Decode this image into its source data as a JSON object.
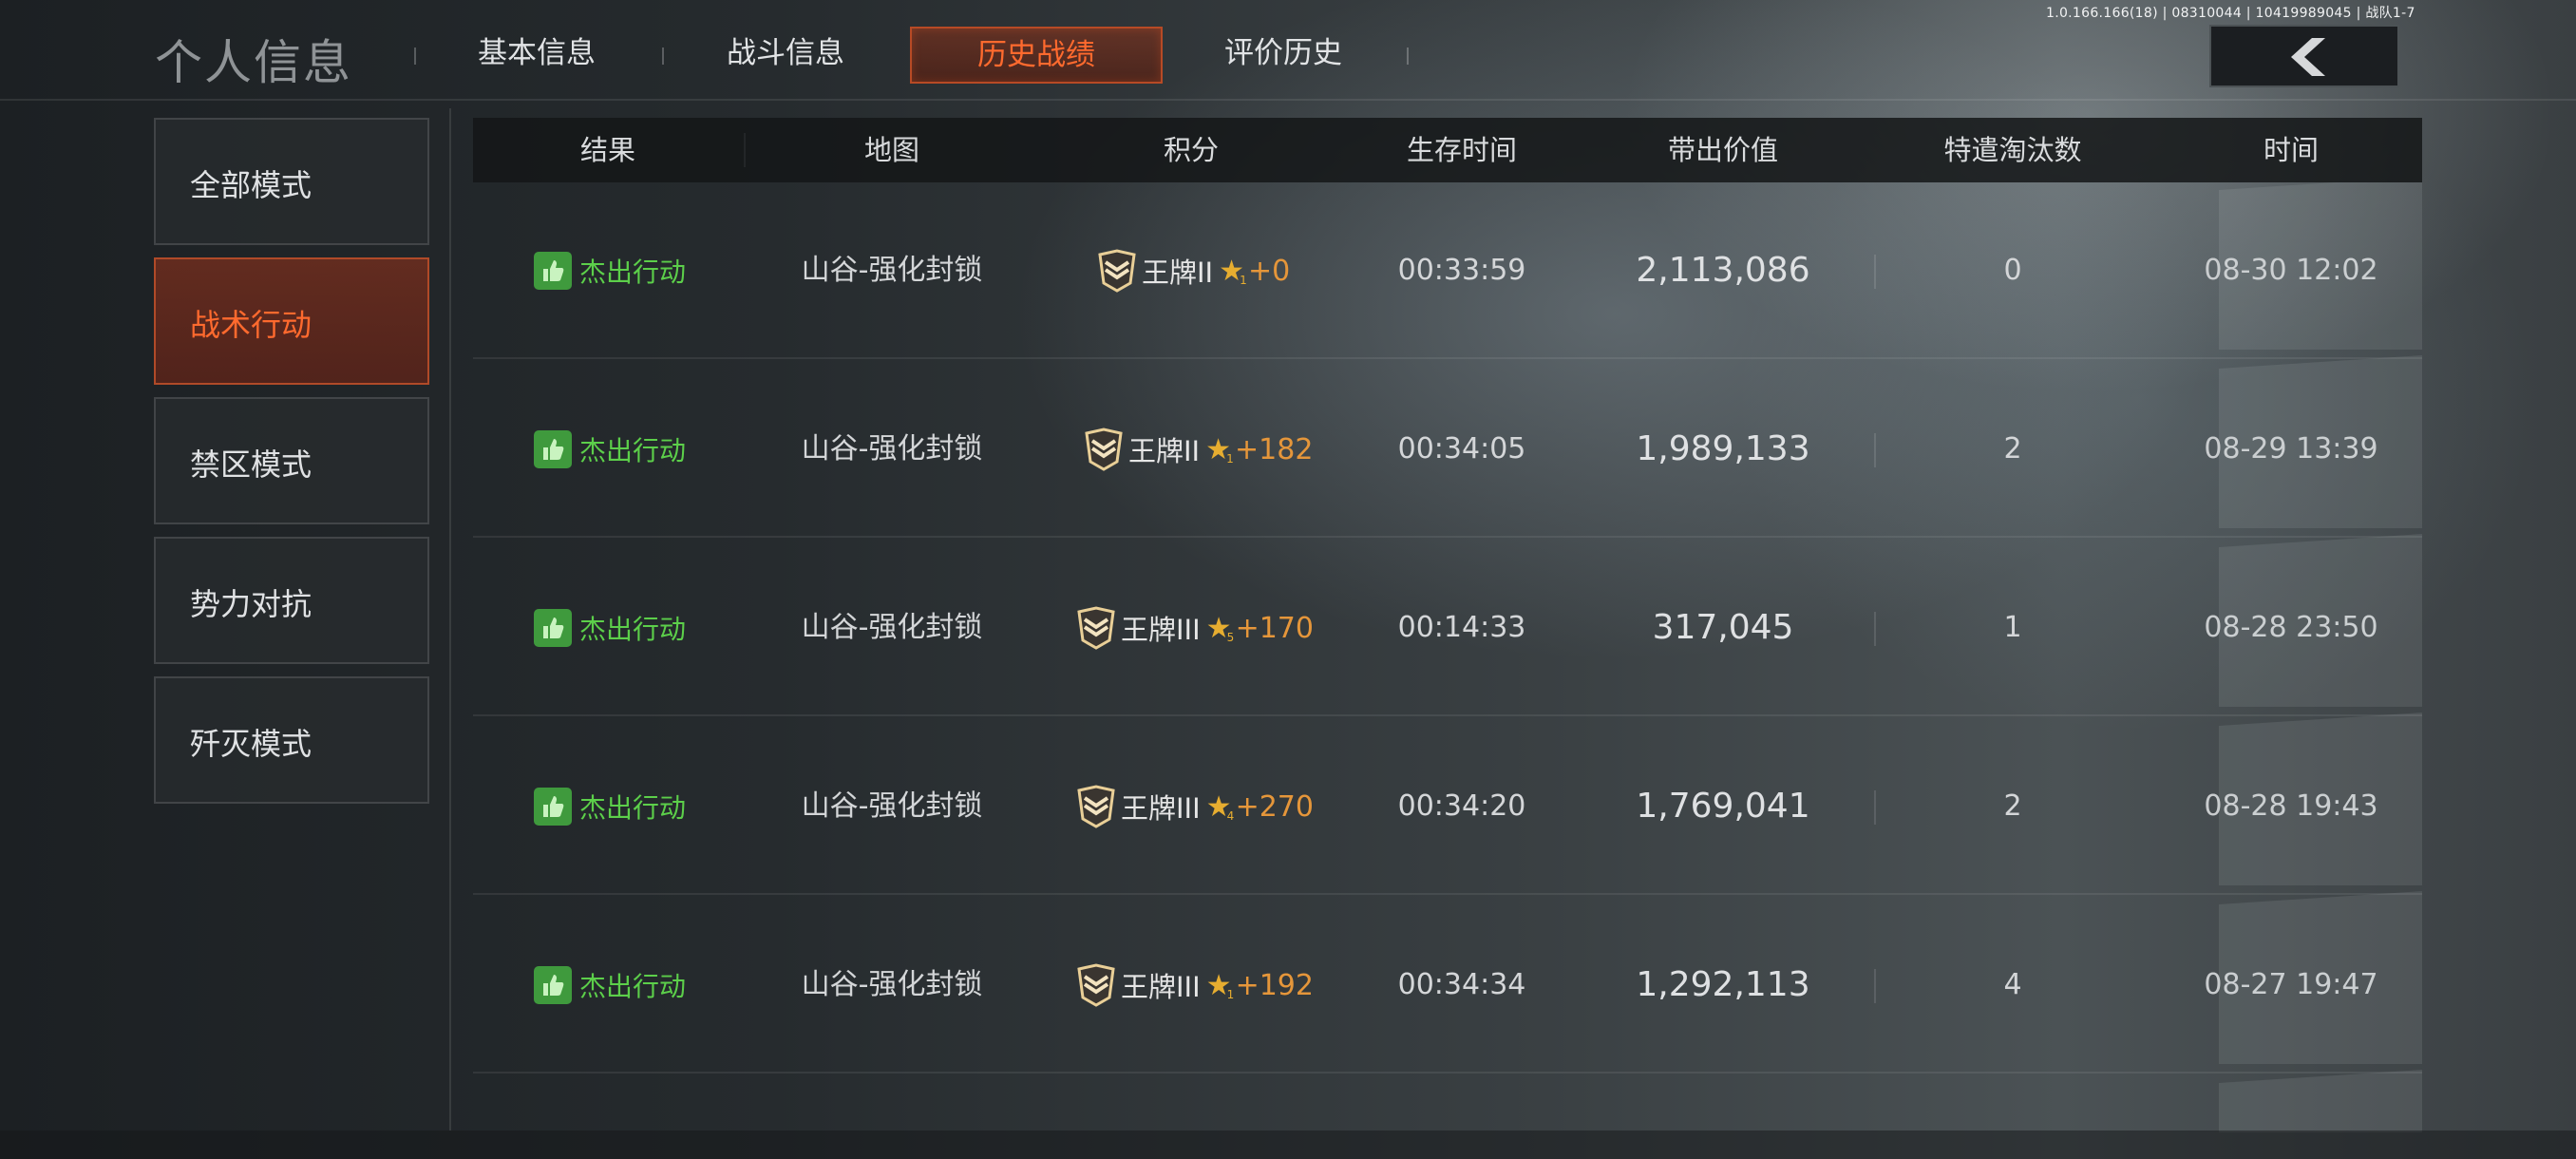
{
  "header": {
    "title": "个人信息",
    "tabs": [
      {
        "label": "基本信息",
        "active": false
      },
      {
        "label": "战斗信息",
        "active": false
      },
      {
        "label": "历史战绩",
        "active": true
      },
      {
        "label": "评价历史",
        "active": false
      }
    ],
    "version": "1.0.166.166(18) | 08310044 | 10419989045 | 战队1-7",
    "back_icon": "chevron-left-icon"
  },
  "sidebar": {
    "modes": [
      {
        "label": "全部模式",
        "active": false
      },
      {
        "label": "战术行动",
        "active": true
      },
      {
        "label": "禁区模式",
        "active": false
      },
      {
        "label": "势力对抗",
        "active": false
      },
      {
        "label": "歼灭模式",
        "active": false
      }
    ]
  },
  "table": {
    "columns": [
      "结果",
      "地图",
      "积分",
      "生存时间",
      "带出价值",
      "特遣淘汰数",
      "时间"
    ],
    "rows": [
      {
        "result": "杰出行动",
        "map": "山谷-强化封锁",
        "rank": "王牌II",
        "star_level": "1",
        "delta": "+0",
        "survival": "00:33:59",
        "value": "2,113,086",
        "kills": "0",
        "time": "08-30 12:02"
      },
      {
        "result": "杰出行动",
        "map": "山谷-强化封锁",
        "rank": "王牌II",
        "star_level": "1",
        "delta": "+182",
        "survival": "00:34:05",
        "value": "1,989,133",
        "kills": "2",
        "time": "08-29 13:39"
      },
      {
        "result": "杰出行动",
        "map": "山谷-强化封锁",
        "rank": "王牌III",
        "star_level": "5",
        "delta": "+170",
        "survival": "00:14:33",
        "value": "317,045",
        "kills": "1",
        "time": "08-28 23:50"
      },
      {
        "result": "杰出行动",
        "map": "山谷-强化封锁",
        "rank": "王牌III",
        "star_level": "4",
        "delta": "+270",
        "survival": "00:34:20",
        "value": "1,769,041",
        "kills": "2",
        "time": "08-28 19:43"
      },
      {
        "result": "杰出行动",
        "map": "山谷-强化封锁",
        "rank": "王牌III",
        "star_level": "1",
        "delta": "+192",
        "survival": "00:34:34",
        "value": "1,292,113",
        "kills": "4",
        "time": "08-27 19:47"
      }
    ]
  },
  "colors": {
    "accent": "#ff6a2e",
    "success": "#5ccf4a",
    "score": "#e5963a",
    "star": "#e6ad30"
  }
}
